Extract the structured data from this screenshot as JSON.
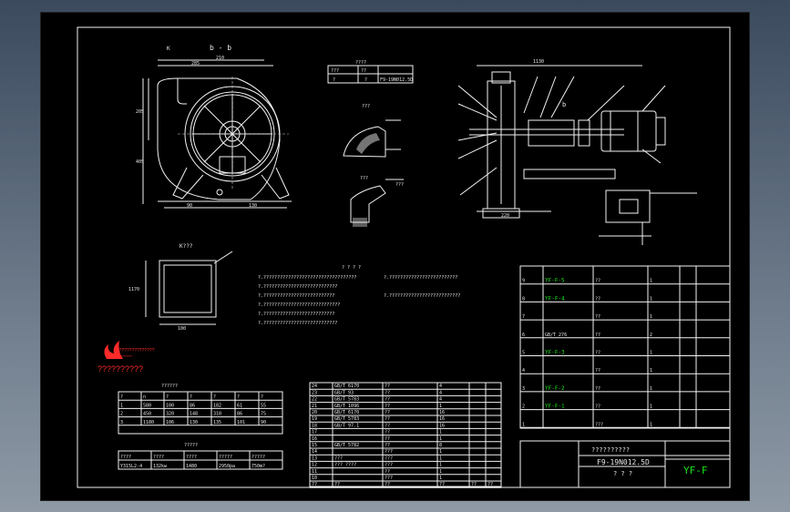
{
  "views": {
    "front_view_label": "b - b",
    "marker_k": "K",
    "detail_k_label": "K???",
    "detail_top_label": "???",
    "detail_mid_label": "???",
    "detail_mid_label2": "???",
    "side_view_label_b": "b",
    "front_dims": [
      "285",
      "210",
      "205",
      "405",
      "90",
      "130"
    ],
    "side_dims": [
      "1130",
      "220"
    ],
    "detail_k_dims": [
      "1170",
      "100"
    ]
  },
  "spec_table": {
    "header": "????",
    "cells": [
      "???",
      "??",
      "?",
      "?",
      "F9-19N012.5D"
    ]
  },
  "notes": {
    "heading": "? ? ? ?",
    "lines": [
      "?.??????????????????????????????????",
      "?.???????????????????????????",
      "?.??????????????????????????",
      "?.????????????????????????????",
      "?.??????????????????????????",
      "?.???????????????????????????",
      "?.?????????????????????????",
      "?.??????????????????????????"
    ]
  },
  "logo": {
    "name": "??????????",
    "company_line": "????????????????",
    "tagline": "????????????"
  },
  "perf_table": {
    "title": "??????",
    "headers": [
      "?",
      "n",
      "?",
      "?",
      "?",
      "?",
      "?"
    ],
    "rows": [
      [
        "1",
        "580",
        "100",
        "86",
        "182",
        "61",
        "55"
      ],
      [
        "2",
        "450",
        "320",
        "148",
        "310",
        "86",
        "75"
      ],
      [
        "3",
        "1180",
        "106",
        "130",
        "135",
        "101",
        "90"
      ]
    ]
  },
  "motor_table": {
    "title": "?????",
    "headers": [
      "????",
      "????",
      "????",
      "?????",
      "?????"
    ],
    "row": [
      "Y315L2-4",
      "132kw",
      "1480",
      "2950pa",
      "750m?"
    ]
  },
  "parts_left": {
    "header": [
      "??",
      "??",
      "??",
      "??",
      "??",
      "??"
    ],
    "rows": [
      [
        "24",
        "GB/T 6170",
        "??",
        "4",
        "",
        ""
      ],
      [
        "23",
        "GB/T 93",
        "??",
        "4",
        "",
        ""
      ],
      [
        "22",
        "GB/T 5783",
        "??",
        "4",
        "",
        ""
      ],
      [
        "21",
        "GB/T 1096",
        "??",
        "1",
        "",
        ""
      ],
      [
        "20",
        "GB/T 6170",
        "??",
        "16",
        "",
        ""
      ],
      [
        "19",
        "GB/T 5783",
        "??",
        "16",
        "",
        ""
      ],
      [
        "18",
        "GB/T 97.1",
        "??",
        "16",
        "",
        ""
      ],
      [
        "17",
        "",
        "??",
        "1",
        "",
        ""
      ],
      [
        "16",
        "",
        "??",
        "1",
        "",
        ""
      ],
      [
        "15",
        "GB/T 5782",
        "??",
        "8",
        "",
        ""
      ],
      [
        "14",
        "",
        "???",
        "1",
        "",
        ""
      ],
      [
        "13",
        "???",
        "???",
        "1",
        "",
        ""
      ],
      [
        "12",
        "??? ????",
        "???",
        "1",
        "",
        ""
      ],
      [
        "11",
        "",
        "??",
        "1",
        "",
        ""
      ],
      [
        "10",
        "",
        "???",
        "1",
        "",
        ""
      ]
    ]
  },
  "parts_right": {
    "rows": [
      [
        "9",
        "YF-F-5",
        "??",
        "1",
        "",
        ""
      ],
      [
        "8",
        "YF-F-4",
        "??",
        "1",
        "",
        ""
      ],
      [
        "7",
        "",
        "??",
        "1",
        "",
        ""
      ],
      [
        "6",
        "GB/T 276",
        "??",
        "2",
        "",
        ""
      ],
      [
        "5",
        "YF-F-3",
        "??",
        "1",
        "",
        ""
      ],
      [
        "4",
        "",
        "??",
        "1",
        "",
        ""
      ],
      [
        "3",
        "YF-F-2",
        "??",
        "1",
        "",
        ""
      ],
      [
        "2",
        "YF-F-1",
        "??",
        "1",
        "",
        ""
      ],
      [
        "1",
        "",
        "???",
        "1",
        "",
        ""
      ]
    ]
  },
  "title_block": {
    "project": "??????????",
    "drawing_name": "F9-19N012.5D",
    "sub": "? ? ?",
    "code": "YF-F"
  },
  "colors": {
    "sheet_bg": "#000000",
    "lines": "#f2f2f2",
    "highlight_green": "#19e619",
    "highlight_yellow": "#e6e619",
    "logo_red": "#ff2a2a"
  }
}
